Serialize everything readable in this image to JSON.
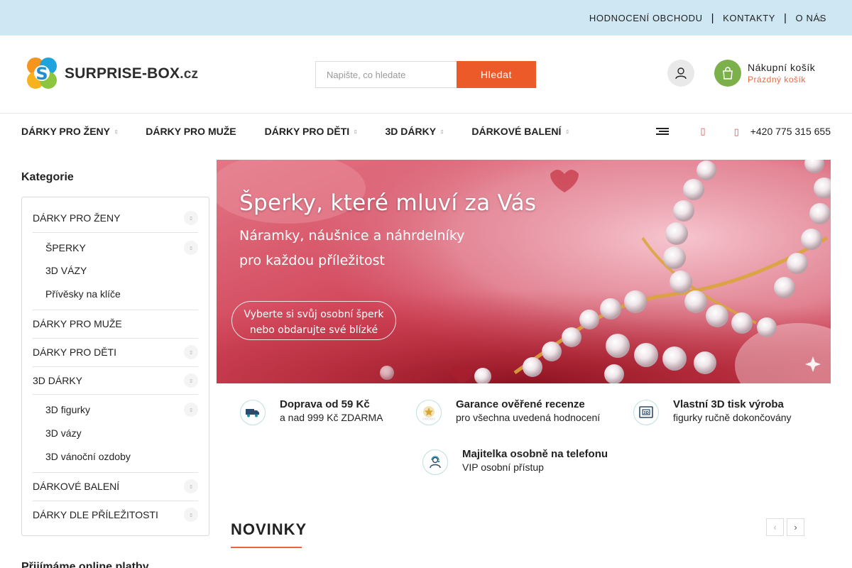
{
  "topbar": {
    "links": [
      "HODNOCENÍ OBCHODU",
      "KONTAKTY",
      "O NÁS"
    ]
  },
  "header": {
    "logo_text": "SURPRISE-BOX",
    "logo_suffix": ".cz",
    "search_placeholder": "Napište, co hledate",
    "search_button": "Hledat",
    "cart_title": "Nákupní košík",
    "cart_status": "Prázdný košík"
  },
  "nav": {
    "items": [
      "DÁRKY PRO ŽENY",
      "DÁRKY PRO MUŽE",
      "DÁRKY PRO DĚTI",
      "3D DÁRKY",
      "DÁRKOVÉ BALENÍ"
    ],
    "phone": "+420 775 315 655"
  },
  "sidebar": {
    "title": "Kategorie",
    "items": [
      {
        "label": "DÁRKY PRO ŽENY"
      },
      {
        "label": "ŠPERKY"
      },
      {
        "label": "3D VÁZY"
      },
      {
        "label": "Přívěsky na klíče"
      },
      {
        "label": "DÁRKY PRO MUŽE"
      },
      {
        "label": "DÁRKY PRO DĚTI"
      },
      {
        "label": "3D DÁRKY"
      },
      {
        "label": "3D figurky"
      },
      {
        "label": "3D vázy"
      },
      {
        "label": "3D vánoční ozdoby"
      },
      {
        "label": "DÁRKOVÉ BALENÍ"
      },
      {
        "label": "DÁRKY DLE PŘÍLEŽITOSTI"
      }
    ],
    "bottom_title": "Přijímáme online platby"
  },
  "banner": {
    "headline": "Šperky, které mluví za Vás",
    "line1": "Náramky, náušnice a náhrdelníky",
    "line2": "pro každou příležitost",
    "cta_line1": "Vyberte si svůj osobní šperk",
    "cta_line2": "nebo obdarujte své blízké"
  },
  "benefits": [
    {
      "title": "Doprava od 59 Kč",
      "text": "a nad 999 Kč ZDARMA",
      "icon": "truck-icon"
    },
    {
      "title": "Garance ověřené recenze",
      "text": "pro všechna uvedená hodnocení",
      "icon": "star-badge-icon"
    },
    {
      "title": "Vlastní 3D tisk výroba",
      "text": "figurky ručně dokončovány",
      "icon": "3d-printer-icon"
    },
    {
      "title": "Majitelka osobně na telefonu",
      "text": "VIP osobní přístup",
      "icon": "support-person-icon"
    }
  ],
  "novinky": {
    "title": "NOVINKY"
  },
  "colors": {
    "topbar_bg": "#cfe6f3",
    "accent": "#ec5a2a",
    "cart_green": "#7bb04a",
    "cart_status": "#e26a45"
  }
}
